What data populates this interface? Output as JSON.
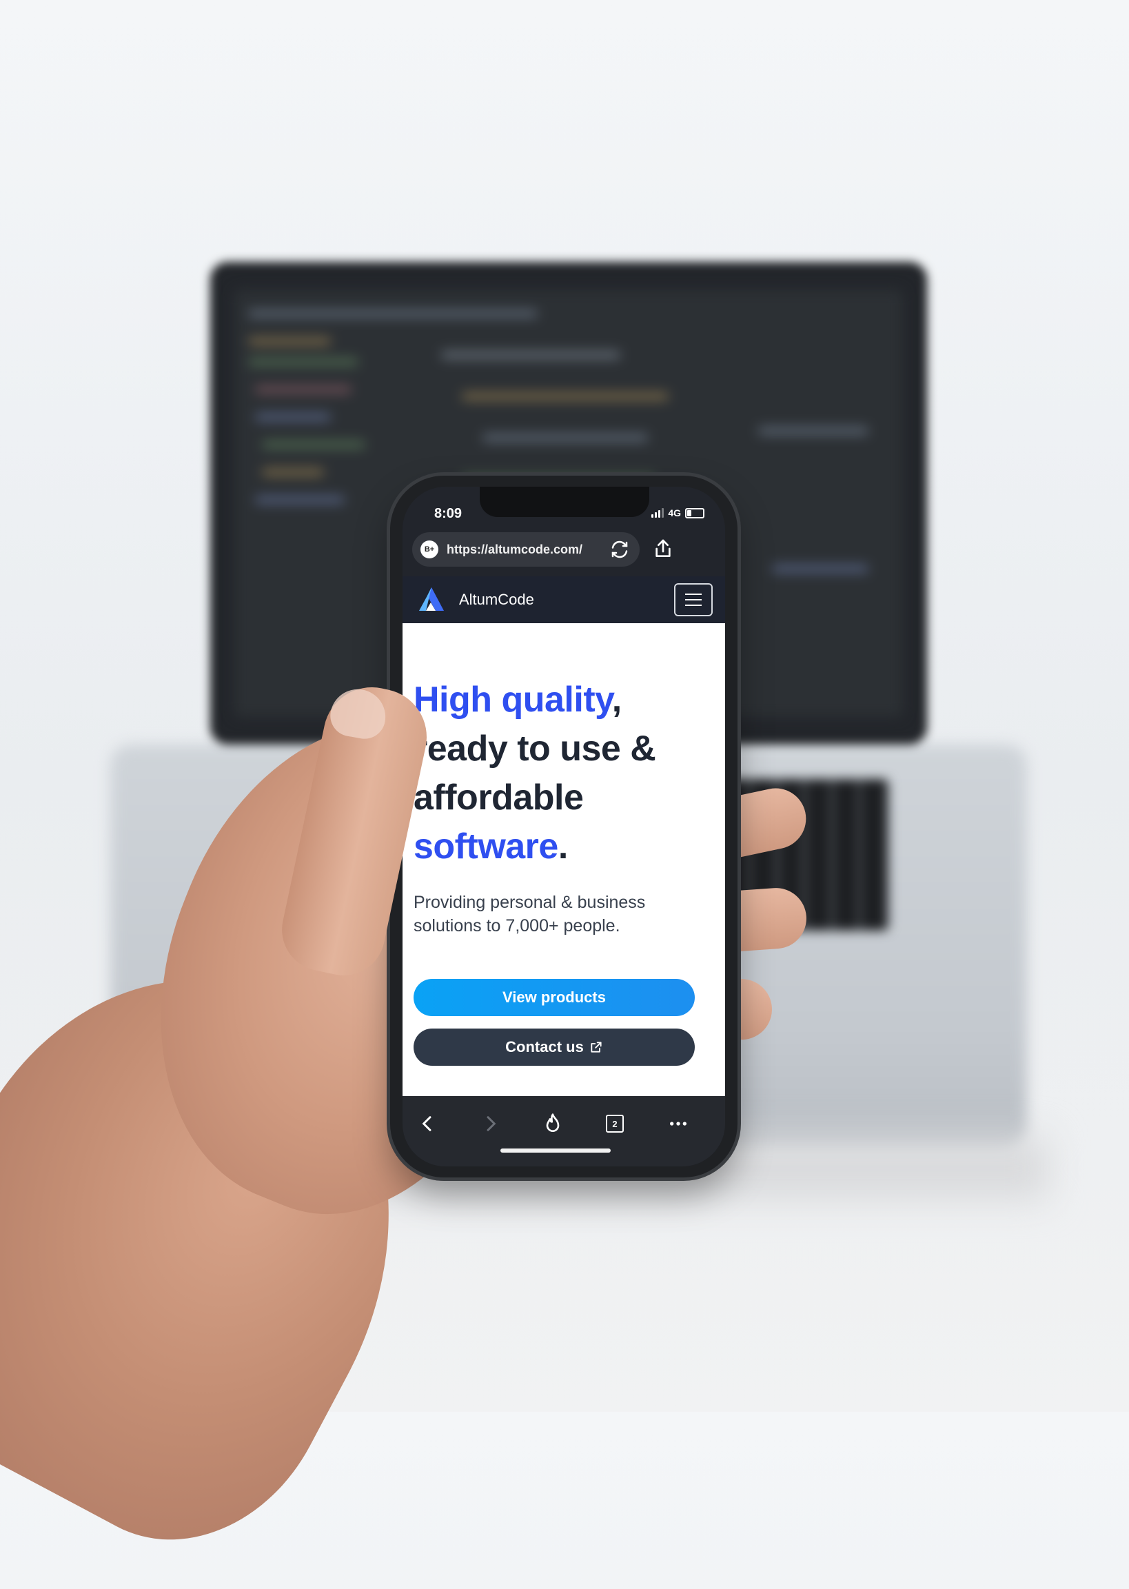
{
  "status_bar": {
    "time": "8:09",
    "network": "4G"
  },
  "browser": {
    "url": "https://altumcode.com/",
    "site_badge": "B+",
    "tab_count": "2"
  },
  "site": {
    "brand": "AltumCode",
    "hero": {
      "accent_1": "High quality",
      "comma": ",",
      "line_2": "ready to use &",
      "line_3": "affordable",
      "accent_2": "software",
      "period": "."
    },
    "subtitle": "Providing personal & business solutions to 7,000+ people.",
    "primary_button": "View products",
    "secondary_button": "Contact us"
  },
  "icons": {
    "reload": "reload-icon",
    "share": "share-icon",
    "menu": "hamburger-menu-icon",
    "external": "external-link-icon",
    "back": "chevron-left-icon",
    "forward": "chevron-right-icon",
    "fire": "fire-icon",
    "tabs": "tabs-icon",
    "more": "more-dots-icon"
  },
  "colors": {
    "accent_blue": "#2f4ff0",
    "primary_button": "#0aa2f5",
    "secondary_button": "#2f3948",
    "site_nav": "#1e2330"
  }
}
